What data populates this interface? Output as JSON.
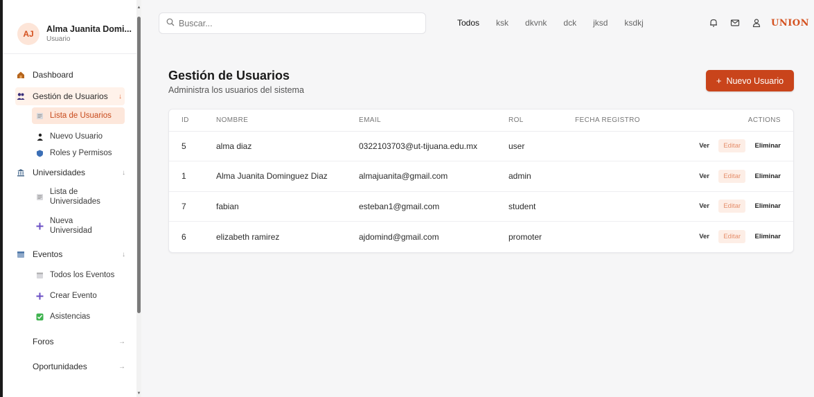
{
  "user": {
    "initials": "AJ",
    "name": "Alma Juanita Domi...",
    "role": "Usuario"
  },
  "nav": {
    "dashboard": "Dashboard",
    "gestion": "Gestión de Usuarios",
    "lista_usuarios": "Lista de Usuarios",
    "nuevo_usuario": "Nuevo Usuario",
    "roles": "Roles y Permisos",
    "universidades": "Universidades",
    "lista_universidades": "Lista de Universidades",
    "nueva_universidad": "Nueva Universidad",
    "eventos": "Eventos",
    "todos_eventos": "Todos los Eventos",
    "crear_evento": "Crear Evento",
    "asistencias": "Asistencias",
    "foros": "Foros",
    "oportunidades": "Oportunidades"
  },
  "search": {
    "placeholder": "Buscar..."
  },
  "tabs": [
    "Todos",
    "ksk",
    "dkvnk",
    "dck",
    "jksd",
    "ksdkj"
  ],
  "logo": "UNION",
  "page": {
    "title": "Gestión de Usuarios",
    "subtitle": "Administra los usuarios del sistema",
    "new_button": "Nuevo Usuario"
  },
  "table": {
    "headers": {
      "id": "ID",
      "nombre": "NOMBRE",
      "email": "EMAIL",
      "rol": "ROL",
      "fecha": "FECHA REGISTRO",
      "actions": "ACTIONS"
    },
    "rows": [
      {
        "id": "5",
        "nombre": "alma diaz",
        "email": "0322103703@ut-tijuana.edu.mx",
        "rol": "user",
        "fecha": ""
      },
      {
        "id": "1",
        "nombre": "Alma Juanita Dominguez Diaz",
        "email": "almajuanita@gmail.com",
        "rol": "admin",
        "fecha": ""
      },
      {
        "id": "7",
        "nombre": "fabian",
        "email": "esteban1@gmail.com",
        "rol": "student",
        "fecha": ""
      },
      {
        "id": "6",
        "nombre": "elizabeth ramirez",
        "email": "ajdomind@gmail.com",
        "rol": "promoter",
        "fecha": ""
      }
    ],
    "actions": {
      "ver": "Ver",
      "editar": "Editar",
      "eliminar": "Eliminar"
    }
  },
  "colors": {
    "accent": "#c9441b",
    "accent_soft": "#fde7db",
    "avatar_bg": "#fde5d8"
  }
}
